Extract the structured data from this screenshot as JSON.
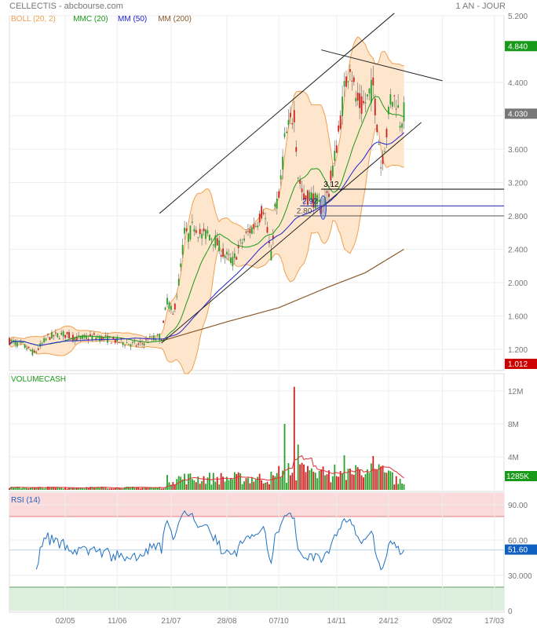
{
  "header": {
    "title": "CELLECTIS - abcbourse.com",
    "period": "1 AN - JOUR"
  },
  "chart_data": [
    {
      "type": "candlestick",
      "panel": "price",
      "legend": [
        {
          "label": "BOLL (20, 2)",
          "color": "#f0a050"
        },
        {
          "label": "MMC (20)",
          "color": "#1a9a1a"
        },
        {
          "label": "MM (50)",
          "color": "#2020d0"
        },
        {
          "label": "MM (200)",
          "color": "#8b5a2b"
        }
      ],
      "ylim": [
        1.0,
        5.2
      ],
      "yticks": [
        "5.200",
        "4.400",
        "4.000",
        "3.600",
        "3.200",
        "2.800",
        "2.400",
        "2.000",
        "1.600",
        "1.200"
      ],
      "ytick_values": [
        5.2,
        4.4,
        4.0,
        3.6,
        3.2,
        2.8,
        2.4,
        2.0,
        1.6,
        1.2
      ],
      "close_path": [
        [
          0,
          1.3
        ],
        [
          7,
          1.25
        ],
        [
          13,
          1.15
        ],
        [
          20,
          1.35
        ],
        [
          28,
          1.38
        ],
        [
          36,
          1.33
        ],
        [
          44,
          1.35
        ],
        [
          52,
          1.32
        ],
        [
          60,
          1.28
        ],
        [
          67,
          1.25
        ],
        [
          73,
          1.32
        ],
        [
          79,
          1.35
        ],
        [
          82,
          1.8
        ],
        [
          85,
          1.6
        ],
        [
          88,
          2.0
        ],
        [
          91,
          2.6
        ],
        [
          93,
          2.55
        ],
        [
          96,
          2.7
        ],
        [
          100,
          2.55
        ],
        [
          103,
          2.6
        ],
        [
          107,
          2.5
        ],
        [
          111,
          2.35
        ],
        [
          116,
          2.25
        ],
        [
          120,
          2.45
        ],
        [
          124,
          2.6
        ],
        [
          128,
          2.7
        ],
        [
          132,
          2.9
        ],
        [
          136,
          2.3
        ],
        [
          138,
          2.9
        ],
        [
          140,
          3.0
        ],
        [
          143,
          3.7
        ],
        [
          145,
          3.85
        ],
        [
          148,
          4.05
        ],
        [
          150,
          3.3
        ],
        [
          153,
          3.0
        ],
        [
          156,
          3.05
        ],
        [
          160,
          2.95
        ],
        [
          162,
          2.9
        ],
        [
          166,
          3.1
        ],
        [
          169,
          3.5
        ],
        [
          171,
          3.8
        ],
        [
          174,
          4.3
        ],
        [
          177,
          4.65
        ],
        [
          180,
          4.2
        ],
        [
          183,
          4.1
        ],
        [
          186,
          4.2
        ],
        [
          189,
          4.35
        ],
        [
          192,
          3.7
        ],
        [
          193,
          3.4
        ],
        [
          196,
          3.8
        ],
        [
          198,
          4.2
        ],
        [
          201,
          4.2
        ],
        [
          203,
          3.95
        ],
        [
          205,
          4.03
        ]
      ],
      "mm200_path": [
        [
          79,
          1.3
        ],
        [
          113,
          1.53
        ],
        [
          140,
          1.7
        ],
        [
          166,
          1.95
        ],
        [
          185,
          2.12
        ],
        [
          205,
          2.4
        ]
      ],
      "trendlines": [
        [
          [
            78,
            2.83
          ],
          [
            200,
            5.23
          ]
        ],
        [
          [
            162,
            4.79
          ],
          [
            225,
            4.42
          ]
        ],
        [
          [
            79,
            1.275
          ],
          [
            214,
            3.92
          ]
        ]
      ],
      "levels": [
        {
          "label": "3.12",
          "value": 3.12,
          "from": 162,
          "color": "#000"
        },
        {
          "label": "2.92",
          "value": 2.92,
          "from": 151,
          "color": "#2020a0"
        },
        {
          "label": "2.80",
          "value": 2.8,
          "from": 148,
          "color": "#555"
        }
      ],
      "ellipse": {
        "session": 163,
        "price": 2.9
      },
      "last_labels": [
        {
          "text": "4.840",
          "value": 4.84,
          "color": "#1a9a1a"
        },
        {
          "text": "4.030",
          "value": 4.03,
          "color": "#777"
        },
        {
          "text": "1.012",
          "value": 1.012,
          "color": "#cc0000"
        }
      ]
    },
    {
      "type": "bar",
      "panel": "volume",
      "title": "VOLUMECASH",
      "yticks": [
        "12M",
        "8M",
        "4M"
      ],
      "ytick_values": [
        12,
        8,
        4
      ],
      "ylim": [
        0,
        13.5
      ],
      "spikes": [
        [
          143,
          8.0
        ],
        [
          148,
          12.5
        ],
        [
          150,
          5.5
        ],
        [
          174,
          4.2
        ],
        [
          189,
          4.1
        ],
        [
          82,
          1.8
        ],
        [
          136,
          2.2
        ]
      ],
      "last_label": "1285K"
    },
    {
      "type": "line",
      "panel": "rsi",
      "title": "RSI (14)",
      "yticks": [
        "90.00",
        "60.00",
        "30.000",
        "0"
      ],
      "ytick_values": [
        90,
        60,
        30,
        0
      ],
      "ylim": [
        0,
        100
      ],
      "last_label": "51.60",
      "last_value": 51.6
    }
  ],
  "xaxis": {
    "labels": [
      "02/05",
      "11/06",
      "21/07",
      "28/08",
      "07/10",
      "14/11",
      "24/12",
      "05/02",
      "17/03"
    ],
    "sessions": [
      29,
      56,
      84,
      113,
      140,
      170,
      197,
      225,
      252
    ]
  }
}
